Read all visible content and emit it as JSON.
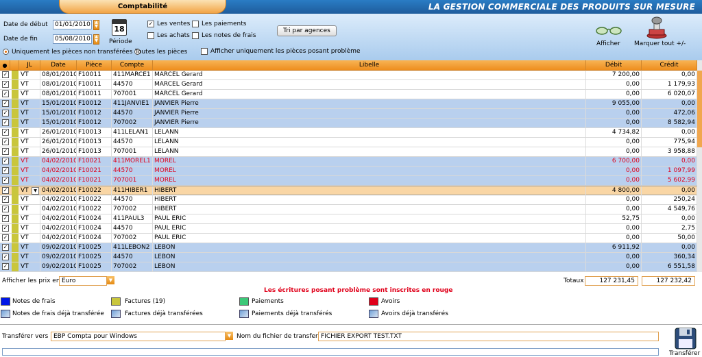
{
  "header": {
    "tab_title": "Comptabilité",
    "slogan": "LA GESTION COMMERCIALE DES PRODUITS SUR MESURE"
  },
  "filters": {
    "date_debut_label": "Date de début",
    "date_debut": "01/01/2010",
    "date_fin_label": "Date de fin",
    "date_fin": "05/08/2010",
    "periode_label": "Période",
    "calendar_day": "18",
    "cb_ventes": "Les ventes",
    "cb_achats": "Les achats",
    "cb_paiements": "Les paiements",
    "cb_notes": "Les notes de frais",
    "tri_button": "Tri par agences",
    "radio_non_transferees": "Uniquement les pièces non transférées",
    "radio_toutes": "Toutes les pièces",
    "cb_probleme": "Afficher uniquement les pièces posant problème",
    "afficher_label": "Afficher",
    "marquer_label": "Marquer tout +/-"
  },
  "grid": {
    "headers": {
      "jl": "JL",
      "date": "Date",
      "piece": "Pièce",
      "compte": "Compte",
      "libelle": "Libelle",
      "debit": "Débit",
      "credit": "Crédit"
    },
    "rows": [
      {
        "jl": "VT",
        "date": "08/01/2010",
        "piece": "F10011",
        "compte": "411MARCE1",
        "libelle": "MARCEL Gerard",
        "debit": "7 200,00",
        "credit": "0,00",
        "style": "normal"
      },
      {
        "jl": "VT",
        "date": "08/01/2010",
        "piece": "F10011",
        "compte": "44570",
        "libelle": "MARCEL Gerard",
        "debit": "0,00",
        "credit": "1 179,93",
        "style": "normal"
      },
      {
        "jl": "VT",
        "date": "08/01/2010",
        "piece": "F10011",
        "compte": "707001",
        "libelle": "MARCEL Gerard",
        "debit": "0,00",
        "credit": "6 020,07",
        "style": "normal"
      },
      {
        "jl": "VT",
        "date": "15/01/2010",
        "piece": "F10012",
        "compte": "411JANVIE1",
        "libelle": "JANVIER Pierre",
        "debit": "9 055,00",
        "credit": "0,00",
        "style": "alt"
      },
      {
        "jl": "VT",
        "date": "15/01/2010",
        "piece": "F10012",
        "compte": "44570",
        "libelle": "JANVIER Pierre",
        "debit": "0,00",
        "credit": "472,06",
        "style": "alt"
      },
      {
        "jl": "VT",
        "date": "15/01/2010",
        "piece": "F10012",
        "compte": "707002",
        "libelle": "JANVIER Pierre",
        "debit": "0,00",
        "credit": "8 582,94",
        "style": "alt"
      },
      {
        "jl": "VT",
        "date": "26/01/2010",
        "piece": "F10013",
        "compte": "411LELAN1",
        "libelle": "LELANN",
        "debit": "4 734,82",
        "credit": "0,00",
        "style": "normal"
      },
      {
        "jl": "VT",
        "date": "26/01/2010",
        "piece": "F10013",
        "compte": "44570",
        "libelle": "LELANN",
        "debit": "0,00",
        "credit": "775,94",
        "style": "normal"
      },
      {
        "jl": "VT",
        "date": "26/01/2010",
        "piece": "F10013",
        "compte": "707001",
        "libelle": "LELANN",
        "debit": "0,00",
        "credit": "3 958,88",
        "style": "normal"
      },
      {
        "jl": "VT",
        "date": "04/02/2010",
        "piece": "F10021",
        "compte": "411MOREL1",
        "libelle": "MOREL",
        "debit": "6 700,00",
        "credit": "0,00",
        "style": "alt-red"
      },
      {
        "jl": "VT",
        "date": "04/02/2010",
        "piece": "F10021",
        "compte": "44570",
        "libelle": "MOREL",
        "debit": "0,00",
        "credit": "1 097,99",
        "style": "alt-red"
      },
      {
        "jl": "VT",
        "date": "04/02/2010",
        "piece": "F10021",
        "compte": "707001",
        "libelle": "MOREL",
        "debit": "0,00",
        "credit": "5 602,99",
        "style": "alt-red"
      },
      {
        "jl": "VT",
        "date": "04/02/2010",
        "piece": "F10022",
        "compte": "411HIBER1",
        "libelle": "HIBERT",
        "debit": "4 800,00",
        "credit": "0,00",
        "style": "sel"
      },
      {
        "jl": "VT",
        "date": "04/02/2010",
        "piece": "F10022",
        "compte": "44570",
        "libelle": "HIBERT",
        "debit": "0,00",
        "credit": "250,24",
        "style": "normal"
      },
      {
        "jl": "VT",
        "date": "04/02/2010",
        "piece": "F10022",
        "compte": "707002",
        "libelle": "HIBERT",
        "debit": "0,00",
        "credit": "4 549,76",
        "style": "normal"
      },
      {
        "jl": "VT",
        "date": "04/02/2010",
        "piece": "F10024",
        "compte": "411PAUL3",
        "libelle": "PAUL ERIC",
        "debit": "52,75",
        "credit": "0,00",
        "style": "normal"
      },
      {
        "jl": "VT",
        "date": "04/02/2010",
        "piece": "F10024",
        "compte": "44570",
        "libelle": "PAUL ERIC",
        "debit": "0,00",
        "credit": "2,75",
        "style": "normal"
      },
      {
        "jl": "VT",
        "date": "04/02/2010",
        "piece": "F10024",
        "compte": "707002",
        "libelle": "PAUL ERIC",
        "debit": "0,00",
        "credit": "50,00",
        "style": "normal"
      },
      {
        "jl": "VT",
        "date": "09/02/2010",
        "piece": "F10025",
        "compte": "411LEBON2",
        "libelle": "LEBON",
        "debit": "6 911,92",
        "credit": "0,00",
        "style": "alt"
      },
      {
        "jl": "VT",
        "date": "09/02/2010",
        "piece": "F10025",
        "compte": "44570",
        "libelle": "LEBON",
        "debit": "0,00",
        "credit": "360,34",
        "style": "alt"
      },
      {
        "jl": "VT",
        "date": "09/02/2010",
        "piece": "F10025",
        "compte": "707002",
        "libelle": "LEBON",
        "debit": "0,00",
        "credit": "6 551,58",
        "style": "alt"
      }
    ]
  },
  "footer": {
    "prix_label": "Afficher les prix en",
    "prix_value": "Euro",
    "warning": "Les écritures posant problème sont inscrites en rouge",
    "totaux_label": "Totaux",
    "total_debit": "127 231,45",
    "total_credit": "127 232,42",
    "legend": {
      "notes": "Notes de frais",
      "factures": "Factures (19)",
      "paiements": "Paiements",
      "avoirs": "Avoirs",
      "notes_t": "Notes de frais déjà transférée",
      "factures_t": "Factures déjà transférées",
      "paiements_t": "Paiements déjà transférés",
      "avoirs_t": "Avoirs déjà transférés"
    },
    "legend_colors": {
      "notes": "#0016e6",
      "factures": "#c9c63c",
      "paiements": "#3cc878",
      "avoirs": "#e0001a"
    },
    "transferer_vers_label": "Transférer vers",
    "transferer_vers_value": "EBP Compta pour Windows",
    "fichier_label": "Nom du fichier de transfert",
    "fichier_value": "FICHIER EXPORT TEST.TXT",
    "transferer_button": "Transférer"
  }
}
